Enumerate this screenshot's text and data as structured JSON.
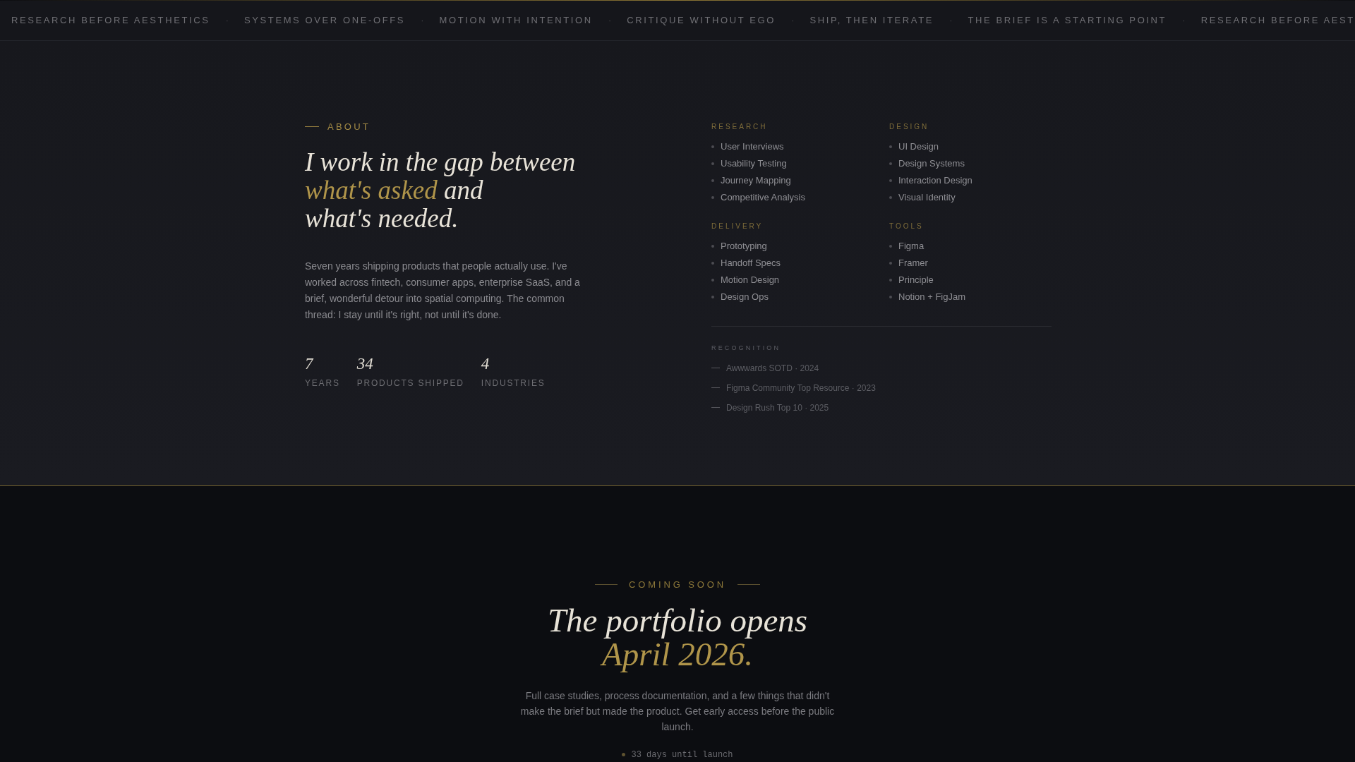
{
  "ticker": [
    {
      "kind": "phrase",
      "text": "RESEARCH BEFORE AESTHETICS"
    },
    {
      "kind": "separator",
      "text": "·"
    },
    {
      "kind": "phrase",
      "text": "SYSTEMS OVER ONE-OFFS"
    },
    {
      "kind": "separator",
      "text": "·"
    },
    {
      "kind": "phrase",
      "text": "MOTION WITH INTENTION"
    },
    {
      "kind": "separator",
      "text": "·"
    },
    {
      "kind": "phrase",
      "text": "CRITIQUE WITHOUT EGO"
    },
    {
      "kind": "separator",
      "text": "·"
    },
    {
      "kind": "phrase",
      "text": "SHIP, THEN ITERATE"
    },
    {
      "kind": "separator",
      "text": "·"
    },
    {
      "kind": "phrase",
      "text": "THE BRIEF IS A STARTING POINT"
    },
    {
      "kind": "separator",
      "text": "·"
    },
    {
      "kind": "phrase",
      "text": "RESEARCH BEFORE AEST"
    }
  ],
  "about": {
    "eyebrow": "ABOUT",
    "headline": [
      {
        "text": "I work in the gap between",
        "accent": false
      },
      {
        "text": "what's asked",
        "accent": true
      },
      {
        "text": "and",
        "accent": false
      },
      {
        "text": "what's needed.",
        "accent": false
      }
    ],
    "body": "Seven years shipping products that people actually use. I've worked across fintech, consumer apps, enterprise SaaS, and a brief, wonderful detour into spatial computing. The common thread: I stay until it's right, not until it's done.",
    "stats": [
      {
        "value": "7",
        "label": "YEARS"
      },
      {
        "value": "34",
        "label": "PRODUCTS SHIPPED"
      },
      {
        "value": "4",
        "label": "INDUSTRIES"
      }
    ]
  },
  "skills": [
    {
      "title": "RESEARCH",
      "items": [
        "User Interviews",
        "Usability Testing",
        "Journey Mapping",
        "Competitive Analysis"
      ]
    },
    {
      "title": "DESIGN",
      "items": [
        "UI Design",
        "Design Systems",
        "Interaction Design",
        "Visual Identity"
      ]
    },
    {
      "title": "DELIVERY",
      "items": [
        "Prototyping",
        "Handoff Specs",
        "Motion Design",
        "Design Ops"
      ]
    },
    {
      "title": "TOOLS",
      "items": [
        "Figma",
        "Framer",
        "Principle",
        "Notion + FigJam"
      ]
    }
  ],
  "recognition": {
    "title": "RECOGNITION",
    "items": [
      "Awwwards SOTD · 2024",
      "Figma Community Top Resource · 2023",
      "Design Rush Top 10 · 2025"
    ]
  },
  "coming_soon": {
    "eyebrow": "COMING SOON",
    "title_line": "The portfolio opens",
    "title_accent": "April 2026.",
    "body": "Full case studies, process documentation, and a few things that didn't make the brief but made the product. Get early access before the public launch.",
    "countdown": "33 days until launch"
  }
}
